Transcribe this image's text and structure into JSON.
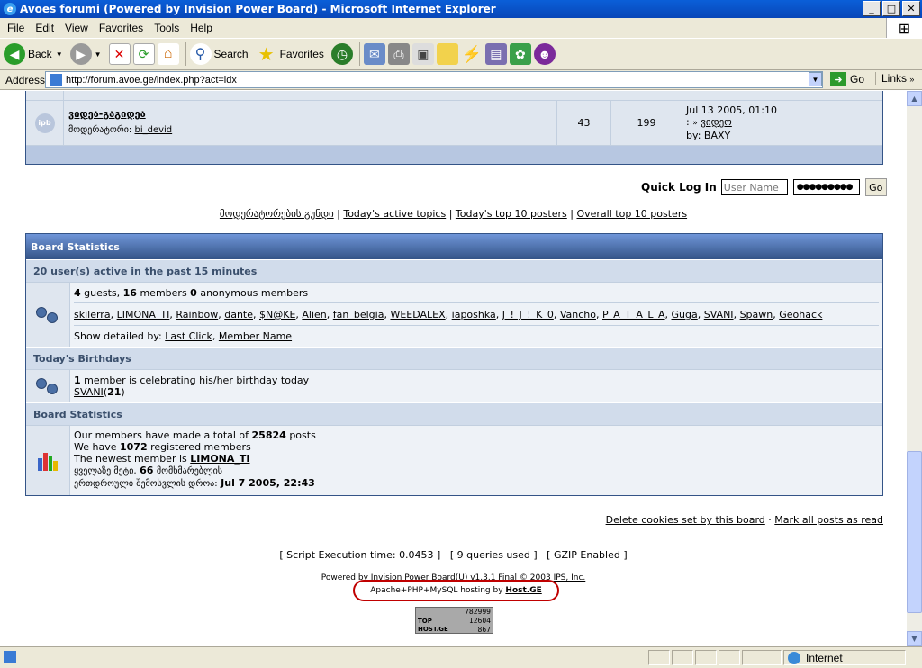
{
  "window": {
    "title": "Avoes forumi (Powered by Invision Power Board) - Microsoft Internet Explorer"
  },
  "menu": [
    "File",
    "Edit",
    "View",
    "Favorites",
    "Tools",
    "Help"
  ],
  "toolbar": {
    "back": "Back",
    "search": "Search",
    "favorites": "Favorites"
  },
  "address": {
    "label": "Address",
    "url": "http://forum.avoe.ge/index.php?act=idx",
    "go": "Go",
    "links": "Links"
  },
  "forum_row": {
    "name": "ვიდეა-გაგიდეა",
    "moderator_label": "მოდერატორი:",
    "moderator": "bi_devid",
    "topics": "43",
    "posts": "199",
    "last_date": "Jul 13 2005, 01:10",
    "last_prefix": ":",
    "last_topic": "ვიდეო",
    "last_by_label": "by:",
    "last_by": "BAXY"
  },
  "login": {
    "label": "Quick Log In",
    "username_placeholder": "User Name",
    "password_value": "●●●●●●●●●",
    "go": "Go"
  },
  "navlinks": [
    "მოდერატორების გუნდი",
    "Today's active topics",
    "Today's top 10 posters",
    "Overall top 10 posters"
  ],
  "stats": {
    "header": "Board Statistics",
    "active_title": "20 user(s) active in the past 15 minutes",
    "guests": "4",
    "members": "16",
    "anonymous": "0",
    "guests_label": "guests,",
    "members_label": "members",
    "anonymous_label": "anonymous members",
    "users": [
      "skilerra",
      "LIMONA_TI",
      "Rainbow",
      "dante",
      "$N@KE",
      "Alien",
      "fan_belgia",
      "WEEDALEX",
      "iaposhka",
      "J_!_J_!_K_0",
      "Vancho",
      "P_A_T_A_L_A",
      "Guga",
      "SVANI",
      "Spawn",
      "Geohack"
    ],
    "detail_label": "Show detailed by:",
    "detail_click": "Last Click",
    "detail_name": "Member Name",
    "birthday_title": "Today's Birthdays",
    "bday_count": "1",
    "bday_text": "member is celebrating his/her birthday today",
    "bday_user": "SVANI",
    "bday_age": "21",
    "board_title": "Board Statistics",
    "posts_pre": "Our members have made a total of",
    "posts_total": "25824",
    "posts_post": "posts",
    "reg_pre": "We have",
    "reg_total": "1072",
    "reg_post": "registered members",
    "newest_pre": "The newest member is",
    "newest": "LIMONA_TI",
    "most_pre": "ყველაზე მეტი,",
    "most_count": "66",
    "most_post": "მომხმარებლის",
    "online_pre": "ერთდროული შემოსვლის დროა:",
    "online_date": "Jul 7 2005, 22:43"
  },
  "footer": {
    "delete_cookies": "Delete cookies set by this board",
    "mark_read": "Mark all posts as read",
    "exec_time": "[ Script Execution time: 0.0453 ]",
    "queries": "[ 9 queries used ]",
    "gzip": "[ GZIP Enabled ]",
    "powered": "Powered by",
    "ipb": "Invision Power Board(U) v1.3.1 Final",
    "copy": "© 2003",
    "ips": "IPS, Inc.",
    "hosting": "Apache+PHP+MySQL hosting by",
    "host": "Host.GE",
    "counter": [
      "782999",
      "12604",
      "867"
    ],
    "counter_top": "TOP",
    "counter_brand": "HOST.GE"
  },
  "status": {
    "zone": "Internet"
  },
  "colors": {
    "title_bar": "#0a5fd8",
    "header_blue": "#345487",
    "row_bg": "#dfe6ef",
    "subhead_bg": "#d1dceb",
    "highlight_circle": "#c00000"
  }
}
